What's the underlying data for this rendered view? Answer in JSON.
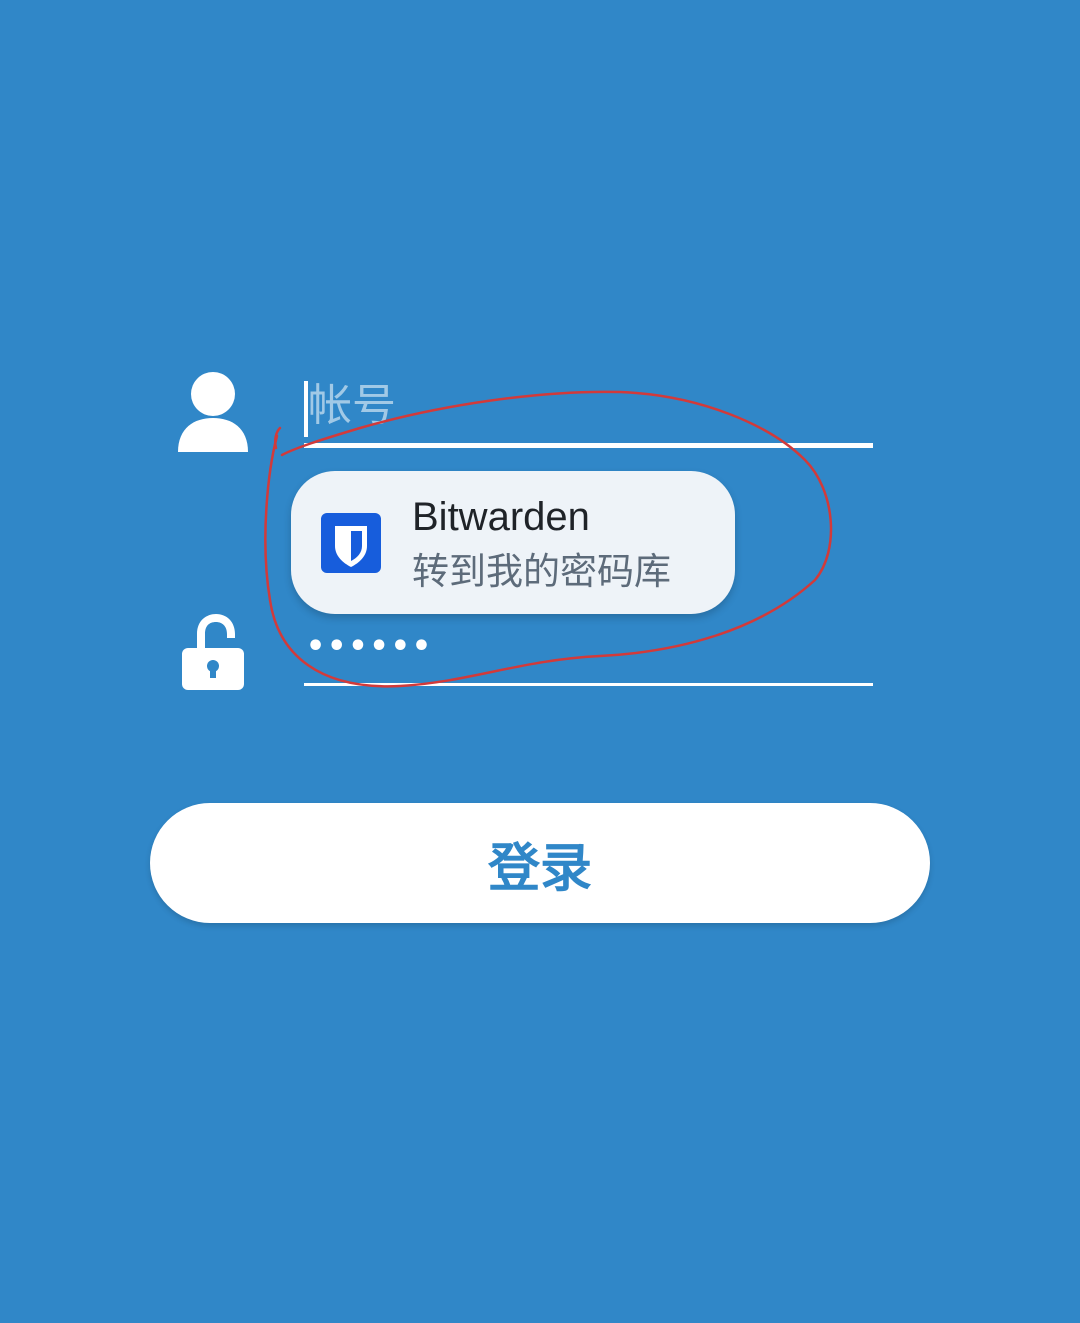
{
  "login_form": {
    "account_placeholder": "帐号",
    "password_masked": "••••••",
    "login_label": "登录"
  },
  "autofill_suggestion": {
    "title": "Bitwarden",
    "subtitle": "转到我的密码库",
    "icon": "bitwarden-shield-icon"
  },
  "colors": {
    "background": "#3087c8",
    "accent": "#3087c8",
    "bitwarden_brand": "#175ddc",
    "annotation": "#d23a3a"
  }
}
